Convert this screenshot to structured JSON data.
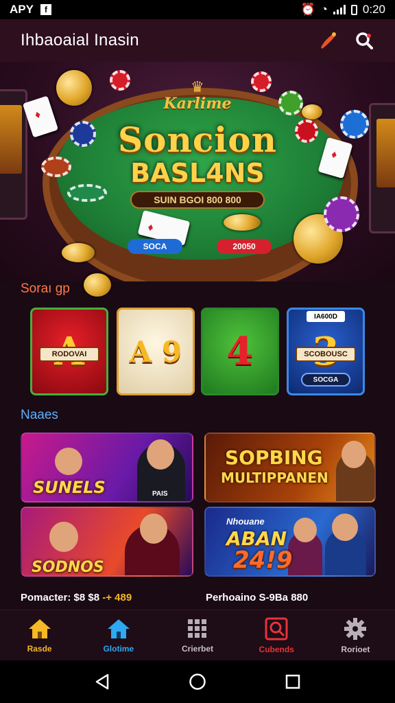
{
  "status_bar": {
    "left_text": "APY",
    "time": "0:20"
  },
  "header": {
    "title": "Ihbaoaial Inasin"
  },
  "hero": {
    "brand": "Karlime",
    "headline_1": "Soncion",
    "headline_2": "BASL4NS",
    "jackpot": "SUIN BGOI  800 800",
    "blue_pill": "SOCA",
    "red_pill": "20050"
  },
  "section_1": {
    "title": "Soraı gp"
  },
  "tiles": [
    {
      "main": "A",
      "tag": "RODOVAI",
      "accent": "#c8101e"
    },
    {
      "main": "A 9",
      "accent": "#f2e6c8"
    },
    {
      "main": "4",
      "accent": "#3c9a2c"
    },
    {
      "main": "3",
      "top_tag": "IA600D",
      "tag": "SCOBOUSC",
      "button": "SOCGA",
      "accent": "#1d4aa8"
    }
  ],
  "section_2": {
    "title": "Naaes"
  },
  "banners": [
    {
      "text": "SUNELS",
      "sub": "PAIS"
    },
    {
      "text_1": "SOPBING",
      "text_2": "MULTIPPANEN"
    },
    {
      "text": "SODNOS"
    },
    {
      "text_1": "ABAN",
      "text_2": "24!9",
      "small": "Nhouane"
    }
  ],
  "captions": [
    {
      "label": "Pomacter: $8 $8",
      "value": "-+ 489"
    },
    {
      "label": "Perhoaino S-9Ba 880"
    }
  ],
  "bottom_nav": [
    {
      "label": "Rasde",
      "color": "#f5b826",
      "icon": "home-icon"
    },
    {
      "label": "Glotime",
      "color": "#2fa8f2",
      "icon": "home-icon"
    },
    {
      "label": "Crierbet",
      "color": "#c8c0c6",
      "icon": "grid-icon"
    },
    {
      "label": "Cubends",
      "color": "#e8333a",
      "icon": "search-icon"
    },
    {
      "label": "Rorioet",
      "color": "#c8c0c6",
      "icon": "gear-icon"
    }
  ]
}
